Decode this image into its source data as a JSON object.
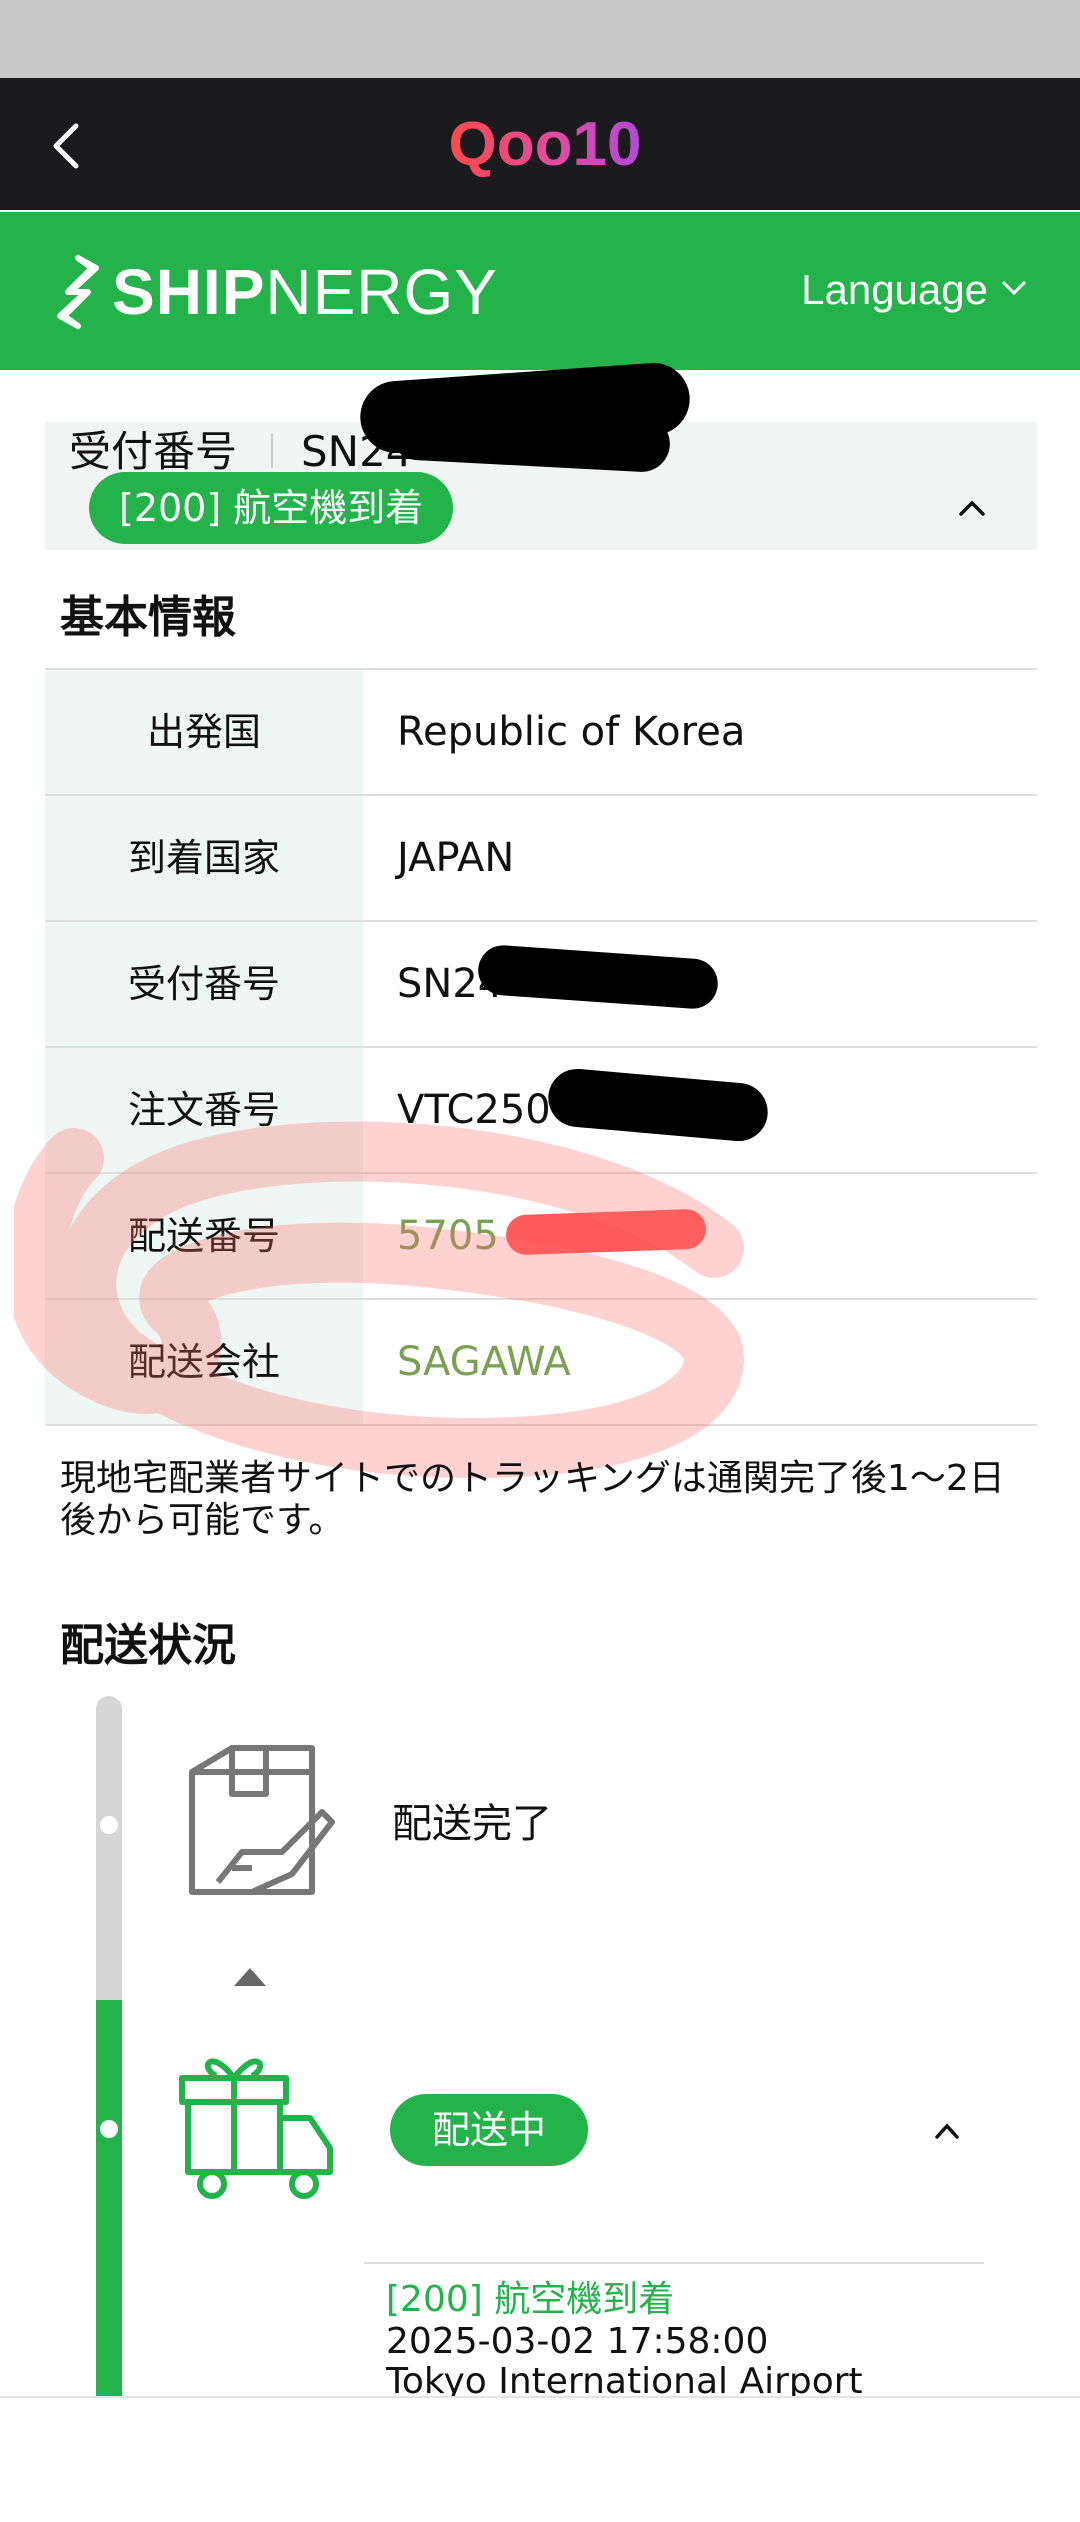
{
  "topbar": {
    "brand": "Qoo10",
    "back_icon": "chevron-left-icon"
  },
  "shipnergy": {
    "brand_bold": "SHIP",
    "brand_light": "NERGY",
    "language_label": "Language"
  },
  "receipt_header": {
    "label": "受付番号",
    "value": "SN24",
    "status_pill": "[200] 航空機到着"
  },
  "basic_info": {
    "title": "基本情報",
    "rows": [
      {
        "label": "出発国",
        "value": "Republic of Korea"
      },
      {
        "label": "到着国家",
        "value": "JAPAN"
      },
      {
        "label": "受付番号",
        "value": "SN24"
      },
      {
        "label": "注文番号",
        "value": "VTC250"
      },
      {
        "label": "配送番号",
        "value": "5705"
      },
      {
        "label": "配送会社",
        "value": "SAGAWA"
      }
    ]
  },
  "note": "現地宅配業者サイトでのトラッキングは通関完了後1～2日後から可能です。",
  "delivery_status": {
    "title": "配送状況",
    "steps": [
      {
        "label": "配送完了",
        "icon": "package-delivered-icon"
      },
      {
        "label": "配送中",
        "icon": "gift-truck-icon"
      }
    ],
    "latest": {
      "status": "[200] 航空機到着",
      "time": "2025-03-02 17:58:00",
      "place": "Tokyo International Airport"
    }
  },
  "colors": {
    "brand_green": "#24b24b",
    "link_green": "#7aa052",
    "topbar_black": "#1b1b1d"
  }
}
